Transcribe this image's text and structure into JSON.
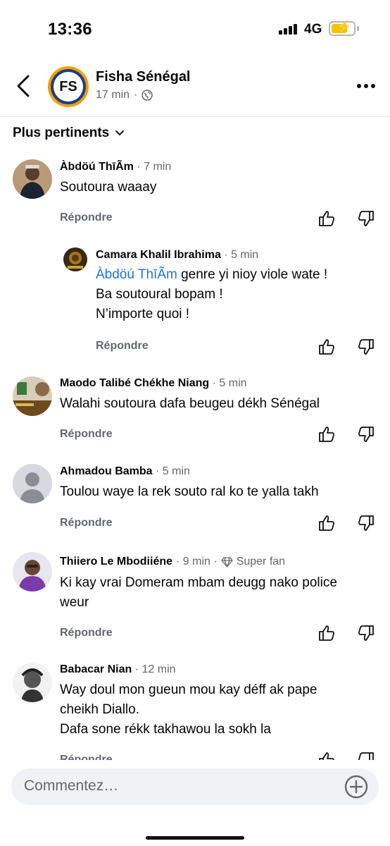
{
  "status": {
    "time": "13:36",
    "network": "4G"
  },
  "header": {
    "page_name": "Fisha Sénégal",
    "page_initials": "FS",
    "age": "17 min"
  },
  "sort": {
    "label": "Plus pertinents"
  },
  "reply_label": "Répondre",
  "comments": [
    {
      "author": "Àbdöú  ThīÃm",
      "time": "· 7 min",
      "lines": [
        "Soutoura waaay"
      ]
    },
    {
      "author": "Camara Khalil Ibrahima",
      "time": "· 5 min",
      "mention": "Àbdöú  ThīÃm",
      "lines": [
        " genre yi nioy viole wate !",
        "Ba soutoural bopam !",
        "N’importe quoi !"
      ]
    },
    {
      "author": "Maodo Talibé Chékhe Niang",
      "time": "· 5 min",
      "lines": [
        "Walahi soutoura dafa beugeu dékh Sénégal"
      ]
    },
    {
      "author": "Ahmadou Bamba",
      "time": "· 5 min",
      "lines": [
        "Toulou waye la rek souto ral ko te yalla takh"
      ]
    },
    {
      "author": "Thiiero Le Mbodiiéne",
      "time": "· 9 min ·",
      "badge": "Super fan",
      "lines": [
        "Ki kay vrai Domeram mbam deugg nako police",
        "weur"
      ]
    },
    {
      "author": "Babacar Nian",
      "time": "· 12 min",
      "lines": [
        "Way doul mon gueun mou kay déff ak pape",
        "cheikh Diallo.",
        "Dafa sone rékk takhawou la sokh la"
      ]
    }
  ],
  "composer": {
    "placeholder": "Commentez…"
  }
}
